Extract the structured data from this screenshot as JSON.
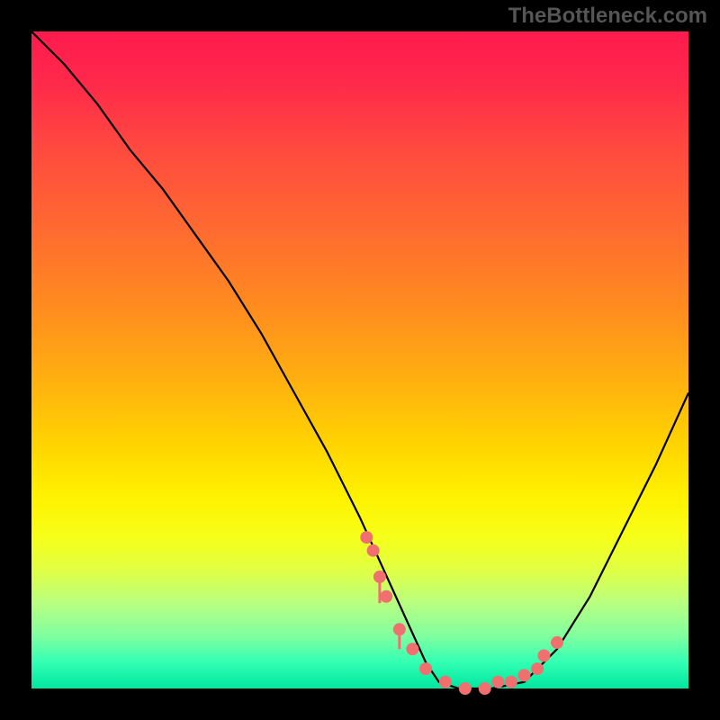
{
  "watermark": "TheBottleneck.com",
  "chart_data": {
    "type": "line",
    "title": "",
    "xlabel": "",
    "ylabel": "",
    "xlim": [
      0,
      100
    ],
    "ylim": [
      0,
      100
    ],
    "series": [
      {
        "name": "curve",
        "x": [
          0,
          5,
          10,
          15,
          20,
          25,
          30,
          35,
          40,
          45,
          50,
          55,
          60,
          62,
          65,
          70,
          75,
          80,
          85,
          90,
          95,
          100
        ],
        "values": [
          100,
          95,
          89,
          82,
          76,
          69,
          62,
          54,
          45,
          36,
          26,
          15,
          4,
          1,
          0,
          0,
          1,
          6,
          14,
          24,
          34,
          45
        ]
      }
    ],
    "markers": {
      "name": "highlighted-points",
      "x": [
        51,
        52,
        53,
        54,
        56,
        58,
        60,
        63,
        66,
        69,
        71,
        73,
        75,
        77,
        78,
        80
      ],
      "values": [
        23,
        21,
        17,
        14,
        9,
        6,
        3,
        1,
        0,
        0,
        1,
        1,
        2,
        3,
        5,
        7
      ]
    },
    "marker_stalks": [
      {
        "x": 53,
        "y": 17,
        "drop": 4
      },
      {
        "x": 56,
        "y": 9,
        "drop": 3
      }
    ],
    "background_gradient": {
      "top_color": "#ff1a4d",
      "bottom_color": "#00e6a0"
    }
  }
}
